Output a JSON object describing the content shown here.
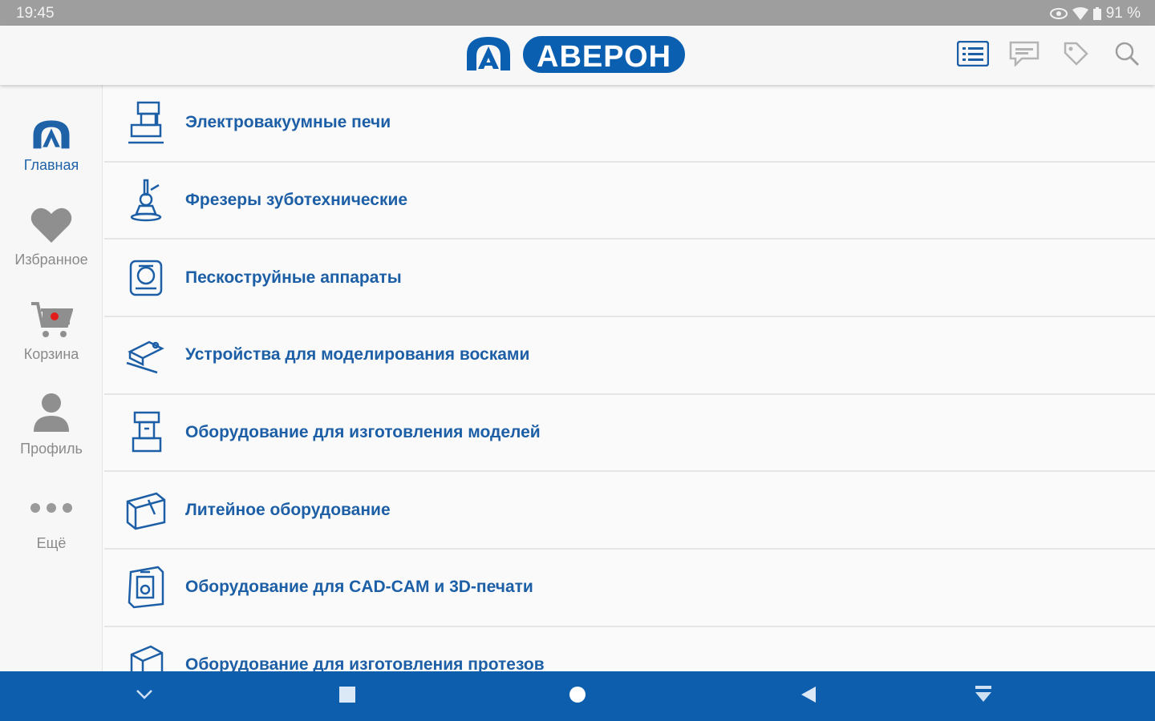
{
  "status": {
    "time": "19:45",
    "battery": "91 %"
  },
  "header": {
    "logo_text": "АВЕРОН"
  },
  "sidebar": {
    "items": [
      {
        "label": "Главная",
        "icon": "averon-logo-icon",
        "active": true
      },
      {
        "label": "Избранное",
        "icon": "heart-icon",
        "active": false
      },
      {
        "label": "Корзина",
        "icon": "cart-icon",
        "active": false
      },
      {
        "label": "Профиль",
        "icon": "profile-icon",
        "active": false
      },
      {
        "label": "Ещё",
        "icon": "more-icon",
        "active": false
      }
    ]
  },
  "categories": [
    {
      "label": "Электровакуумные печи",
      "icon": "furnace-icon"
    },
    {
      "label": "Фрезеры зуботехнические",
      "icon": "micromotor-icon"
    },
    {
      "label": "Пескоструйные аппараты",
      "icon": "sandblaster-icon"
    },
    {
      "label": "Устройства для моделирования восками",
      "icon": "wax-modeling-icon"
    },
    {
      "label": "Оборудование для изготовления моделей",
      "icon": "model-equipment-icon"
    },
    {
      "label": "Литейное оборудование",
      "icon": "casting-icon"
    },
    {
      "label": "Оборудование для CAD-CAM и 3D-печати",
      "icon": "cadcam-icon"
    },
    {
      "label": "Оборудование для изготовления протезов",
      "icon": "prosthesis-icon"
    }
  ],
  "colors": {
    "brand": "#0b5fb0",
    "text_blue": "#1d5fa6",
    "navbar": "#0d5fae",
    "statusbar": "#9e9e9e",
    "cart_dot": "#e21b1b"
  }
}
